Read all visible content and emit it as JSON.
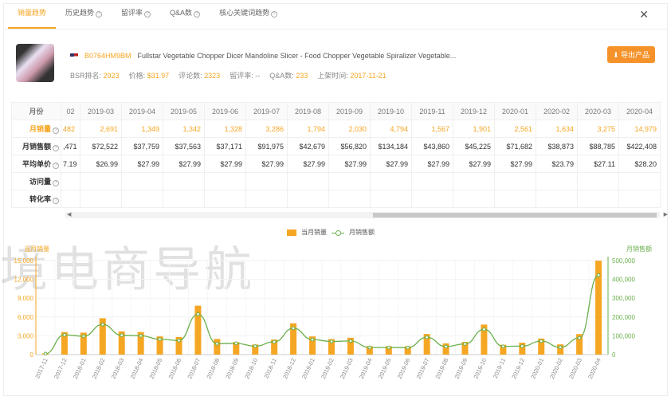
{
  "tabs": [
    "销量趋势",
    "历史趋势",
    "留评率",
    "Q&A数",
    "核心关键词趋势"
  ],
  "product": {
    "asin": "B0764HM9BM",
    "title": "Fullstar Vegetable Chopper Dicer Mandoline Slicer - Food Chopper Vegetable Spiralizer Vegetable...",
    "bsr_label": "BSR排名:",
    "bsr": "2923",
    "price_label": "价格:",
    "price": "$31.97",
    "reviews_label": "评论数:",
    "reviews": "2323",
    "rate_label": "留评率:",
    "rate": "--",
    "qa_label": "Q&A数:",
    "qa": "233",
    "date_label": "上架时间:",
    "date": "2017-11-21",
    "export": "导出产品"
  },
  "table": {
    "months": [
      "02",
      "2019-03",
      "2019-04",
      "2019-05",
      "2019-06",
      "2019-07",
      "2019-08",
      "2019-09",
      "2019-10",
      "2019-11",
      "2019-12",
      "2020-01",
      "2020-02",
      "2020-03",
      "2020-04"
    ],
    "rows": [
      {
        "label": "月份",
        "cells": []
      },
      {
        "label": "月销量",
        "cells": [
          "482",
          "2,691",
          "1,349",
          "1,342",
          "1,328",
          "3,286",
          "1,794",
          "2,030",
          "4,794",
          "1,567",
          "1,901",
          "2,561",
          "1,634",
          "3,275",
          "14,979"
        ]
      },
      {
        "label": "月销售额",
        "cells": [
          ",471",
          "$72,522",
          "$37,759",
          "$37,563",
          "$37,171",
          "$91,975",
          "$42,679",
          "$56,820",
          "$134,184",
          "$43,860",
          "$45,225",
          "$71,682",
          "$38,873",
          "$88,785",
          "$422,408"
        ]
      },
      {
        "label": "平均单价",
        "cells": [
          "7.19",
          "$26.99",
          "$27.99",
          "$27.99",
          "$27.99",
          "$27.99",
          "$27.99",
          "$27.99",
          "$27.99",
          "$27.99",
          "$27.99",
          "$27.99",
          "$23.79",
          "$27.11",
          "$28.20"
        ]
      },
      {
        "label": "访问量",
        "cells": []
      },
      {
        "label": "转化率",
        "cells": []
      }
    ]
  },
  "watermark": "境电商导航",
  "chart_data": {
    "type": "bar+line",
    "categories": [
      "2017-11",
      "2017-12",
      "2018-01",
      "2018-02",
      "2018-03",
      "2018-04",
      "2018-05",
      "2018-06",
      "2018-07",
      "2018-08",
      "2018-09",
      "2018-10",
      "2018-11",
      "2018-12",
      "2019-01",
      "2019-02",
      "2019-03",
      "2019-04",
      "2019-05",
      "2019-06",
      "2019-07",
      "2019-08",
      "2019-09",
      "2019-10",
      "2019-11",
      "2019-12",
      "2020-01",
      "2020-02",
      "2020-03",
      "2020-04"
    ],
    "series": [
      {
        "name": "当月销量",
        "type": "bar",
        "axis": "left",
        "color": "#f5a623",
        "values": [
          200,
          3600,
          3500,
          5800,
          3700,
          3600,
          2900,
          2800,
          7800,
          2500,
          2000,
          1600,
          2400,
          5000,
          2900,
          2482,
          2691,
          1349,
          1342,
          1328,
          3286,
          1794,
          2030,
          4794,
          1567,
          1901,
          2561,
          1634,
          3275,
          14979
        ]
      },
      {
        "name": "月销售额",
        "type": "line",
        "axis": "right",
        "color": "#6ab04c",
        "values": [
          5000,
          105000,
          98000,
          160000,
          103000,
          100000,
          82000,
          75000,
          215000,
          58000,
          60000,
          45000,
          68000,
          140000,
          80000,
          70000,
          72522,
          37759,
          37563,
          37171,
          91975,
          42679,
          56820,
          134184,
          43860,
          45225,
          71682,
          38873,
          88785,
          422408
        ]
      }
    ],
    "left_axis": {
      "label": "当月销量",
      "ylim": [
        0,
        15000
      ],
      "ticks": [
        "0",
        "3,000",
        "6,000",
        "9,000",
        "12,000",
        "15,000"
      ]
    },
    "right_axis": {
      "label": "月销售额",
      "ylim": [
        0,
        500000
      ],
      "ticks": [
        "0",
        "100,000",
        "200,000",
        "300,000",
        "400,000",
        "500,000"
      ]
    },
    "legend": "top-center",
    "grid": true
  }
}
